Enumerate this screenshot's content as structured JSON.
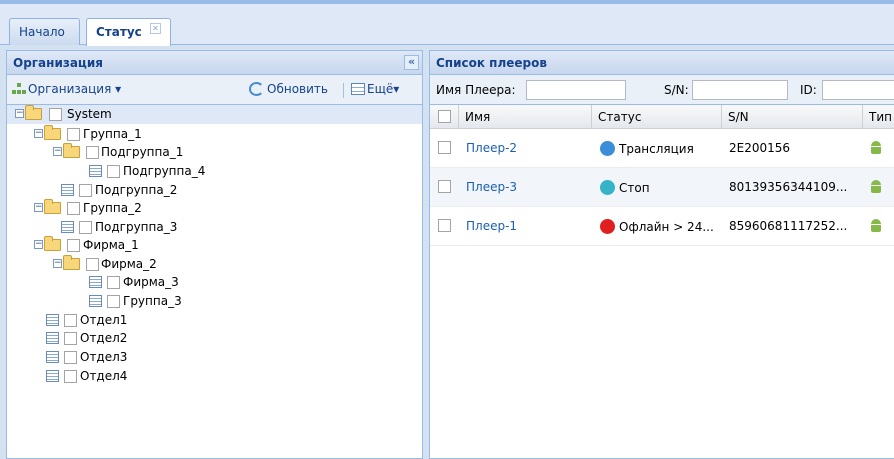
{
  "tabs": [
    {
      "label": "Начало"
    },
    {
      "label": "Статус"
    }
  ],
  "left_panel": {
    "title": "Организация",
    "toolbar": {
      "org_label": "Организация ▾",
      "refresh_label": "Обновить",
      "more_label": "Ещё▾"
    },
    "tree": [
      {
        "label": "System"
      },
      {
        "label": "Группа_1"
      },
      {
        "label": "Подгруппа_1"
      },
      {
        "label": "Подгруппа_4"
      },
      {
        "label": "Подгруппа_2"
      },
      {
        "label": "Группа_2"
      },
      {
        "label": "Подгруппа_3"
      },
      {
        "label": "Фирма_1"
      },
      {
        "label": "Фирма_2"
      },
      {
        "label": "Фирма_3"
      },
      {
        "label": "Группа_3"
      },
      {
        "label": "Отдел1"
      },
      {
        "label": "Отдел2"
      },
      {
        "label": "Отдел3"
      },
      {
        "label": "Отдел4"
      }
    ]
  },
  "right_panel": {
    "title": "Список плееров",
    "filters": {
      "name_label": "Имя Плеера:",
      "sn_label": "S/N:",
      "id_label": "ID:"
    },
    "columns": [
      "Имя",
      "Статус",
      "S/N",
      "Тип"
    ],
    "rows": [
      {
        "name": "Плеер-2",
        "status": "Трансляция",
        "status_color": "#3a8ed8",
        "sn": "2E200156"
      },
      {
        "name": "Плеер-3",
        "status": "Стоп",
        "status_color": "#34b3c9",
        "sn": "80139356344109..."
      },
      {
        "name": "Плеер-1",
        "status": "Офлайн > 24...",
        "status_color": "#e02020",
        "sn": "85960681117252..."
      }
    ]
  },
  "colors": {
    "accent": "#15428b",
    "link": "#1a5fb4"
  }
}
